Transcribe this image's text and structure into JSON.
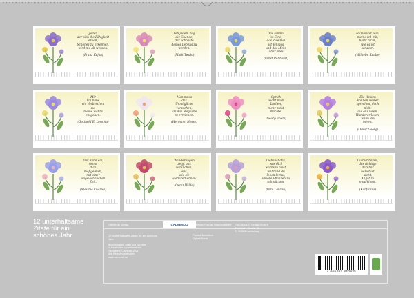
{
  "cover_title": "12 unterhaltsame\nZitate für ein\nschönes Jahr",
  "months": [
    {
      "quote": "Jeder,\nder sich die Fähigkeit\nerhält,\nSchönes zu erkennen,\nwird nie alt werden.\n\n(Franz Kafka)",
      "flower_color": "#8b6fc9",
      "accent": "#e3c84a"
    },
    {
      "quote": "Gib jedem Tag\ndie Chance,\nder schönste\ndeines Lebens zu\nwerden.\n\n(Mark Twain)",
      "flower_color": "#d98bb8",
      "accent": "#f3e27a"
    },
    {
      "quote": "Das Einmal\nist Eine,\ndas Zweimal\nist Einiges\nund das Mehr\nüber alles\n\n(Ernst Rebhorst)",
      "flower_color": "#7a9ad8",
      "accent": "#e8d56a"
    },
    {
      "quote": "Humorvoll sein,\nmeine ich mit,\nheißt nicht,\nwie es ist\nsondern.\n\n(Wilhelm Raabe)",
      "flower_color": "#6a7fc9",
      "accent": "#f3d66a"
    },
    {
      "quote": "Mir\nIch habe\nein Verbrechen\nzu,\nmeine wahre\nentgehen.\n\n(Gotthold E. Lessing)",
      "flower_color": "#9a8ae0",
      "accent": "#e9d86a"
    },
    {
      "quote": "Man muss\ndas\nUnmögliche\nversuchen,\num das Mögliche\nzu erreichen.\n\n(Hermann Hesse)",
      "flower_color": "#f0e6f0",
      "accent": "#f2a07a"
    },
    {
      "quote": "Sprich\nleicht nach\nLachen,\nmehr nicht\nmöchte.\n\n(Georg Ebers)",
      "flower_color": "#ee8fc2",
      "accent": "#d94a8a"
    },
    {
      "quote": "Die Weisen\nkönnen weiter\nsprechen, doch\nnicht\ndie aus ihren,\nWanderer lesen,\nwenn die\nhören.\n\n(Oskar Georg)",
      "flower_color": "#b57ee0",
      "accent": "#e0c860"
    },
    {
      "quote": "Der Rand ein,\nnennt\ndich\nmaßgeblich,\nmit einer\nungewöhnlichen\nZeit.\n\n(Maxima Charles)",
      "flower_color": "#9aa0e8",
      "accent": "#f0b0c0"
    },
    {
      "quote": "Wanderungen\nzeigt uns\nwirklichen,\nwas,\nwie sie\nwiedererkennen.\n\n(Oscar Wilde)",
      "flower_color": "#c24a6a",
      "accent": "#e6c060"
    },
    {
      "quote": "Liebe ist das,\nwas dich\nwachsen lässt,\nwährend du\nleben lernst,\nunsere Pflanzen zu\nschmücken.\n\n(Otto Lanzen)",
      "flower_color": "#b8a0d8",
      "accent": "#d8a0b8"
    },
    {
      "quote": "Du bist bereit,\ndas richtige\ndarüber\nberichtet\nsieht,\nAngst zu\nempfehlen.\n\n(Konfuzius)",
      "flower_color": "#8a5ac8",
      "accent": "#f0b040"
    }
  ],
  "info": {
    "publisher_label": "Calvendo Verlag",
    "logo_text": "CALVENDO",
    "subtitle_line": "12 Unterhaltsame Zitate für ein schönes",
    "subtitle_sub": "Jahr",
    "small_block": "Blumenpracht, Zitate und Sprüche\nin kunstvoller Aquarellmalerei\nGestaltung: Calvendo 2024\nAlle Rechte vorbehalten\nwww.calvendo.de",
    "mid_label": "Kalender-Format Wandkalender",
    "mid_block": "Flowers illustration\nDigitale Kunst",
    "right_block": "CALVENDO Verlag GmbH\nKrefelder Straße 28\nD-86899 Landsberg"
  },
  "barcode": {
    "number": "4 065493 840035"
  }
}
